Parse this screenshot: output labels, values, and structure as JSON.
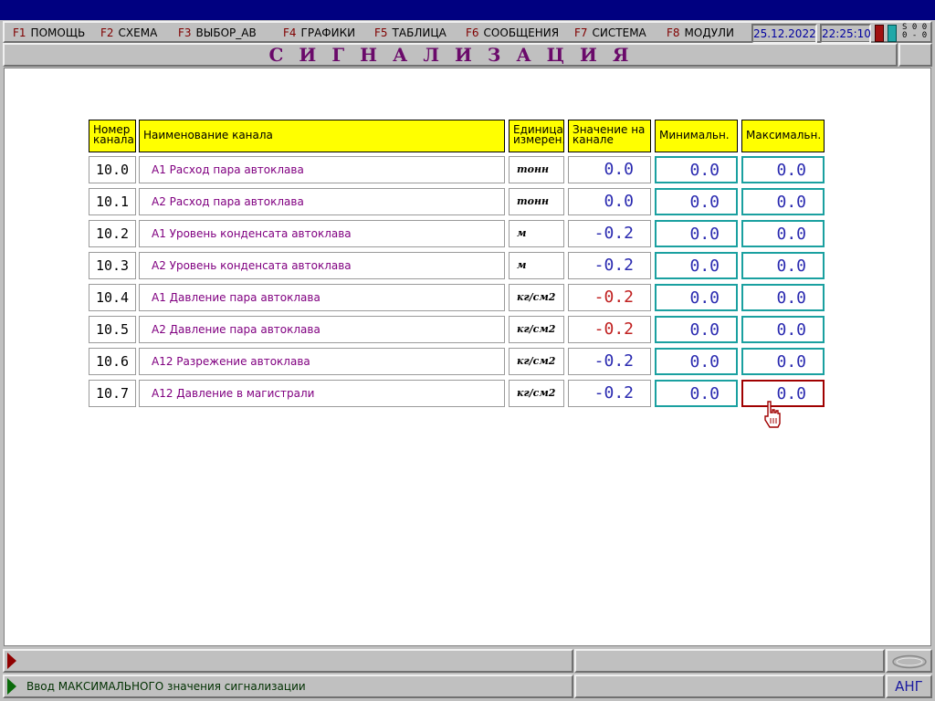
{
  "menu": [
    {
      "key": "F1",
      "label": "ПОМОЩЬ"
    },
    {
      "key": "F2",
      "label": "СХЕМА"
    },
    {
      "key": "F3",
      "label": "ВЫБОР_АВ"
    },
    {
      "key": "F4",
      "label": "ГРАФИКИ"
    },
    {
      "key": "F5",
      "label": "ТАБЛИЦА"
    },
    {
      "key": "F6",
      "label": "СООБЩЕНИЯ"
    },
    {
      "key": "F7",
      "label": "СИСТЕМА"
    },
    {
      "key": "F8",
      "label": "МОДУЛИ"
    }
  ],
  "date": "25.12.2022",
  "time": "22:25:10",
  "indicator_glyphs": [
    "S",
    "0",
    "0",
    "0",
    "-",
    "0"
  ],
  "page_title": "СИГНАЛИЗАЦИЯ",
  "table": {
    "headers": {
      "channel_no": "Номер канала",
      "channel_name": "Наименование канала",
      "unit": "Единица измерен.",
      "value": "Значение на канале",
      "min": "Минимальн.",
      "max": "Максимальн."
    },
    "rows": [
      {
        "no": "10.0",
        "name": "А1   Расход пара автоклава",
        "unit": "тонн",
        "value": "0.0",
        "min": "0.0",
        "max": "0.0"
      },
      {
        "no": "10.1",
        "name": "А2   Расход пара автоклава",
        "unit": "тонн",
        "value": "0.0",
        "min": "0.0",
        "max": "0.0"
      },
      {
        "no": "10.2",
        "name": "А1   Уровень конденсата автоклава",
        "unit": "м",
        "value": "-0.2",
        "min": "0.0",
        "max": "0.0"
      },
      {
        "no": "10.3",
        "name": "А2   Уровень конденсата автоклава",
        "unit": "м",
        "value": "-0.2",
        "min": "0.0",
        "max": "0.0"
      },
      {
        "no": "10.4",
        "name": "А1   Давление пара автоклава",
        "unit": "кг/см2",
        "value": "-0.2",
        "min": "0.0",
        "max": "0.0"
      },
      {
        "no": "10.5",
        "name": "А2   Давление пара автоклава",
        "unit": "кг/см2",
        "value": "-0.2",
        "min": "0.0",
        "max": "0.0"
      },
      {
        "no": "10.6",
        "name": "А12  Разрежение автоклава",
        "unit": "кг/см2",
        "value": "-0.2",
        "min": "0.0",
        "max": "0.0"
      },
      {
        "no": "10.7",
        "name": "А12  Давление в магистрали",
        "unit": "кг/см2",
        "value": "-0.2",
        "min": "0.0",
        "max": "0.0"
      }
    ]
  },
  "status": {
    "message": "Ввод МАКСИМАЛЬНОГО значения сигнализации",
    "language": "АНГ"
  },
  "colors": {
    "title_bar": "#000080",
    "header_fill": "#ffff00",
    "channel_name_text": "#800080",
    "value_text": "#2a2ab0",
    "alarm_value_text": "#c02020",
    "limit_border": "#1aa0a0",
    "selected_border": "#a00000"
  }
}
